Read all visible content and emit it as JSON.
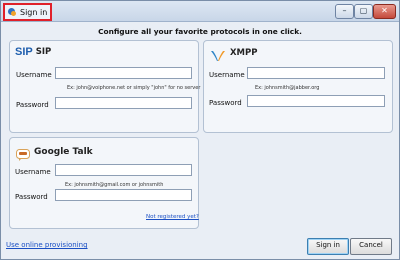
{
  "window": {
    "title": "Sign in",
    "controls": {
      "minimize": "–",
      "maximize": "▢",
      "close": "✕"
    }
  },
  "headline": "Configure all your favorite protocols in one click.",
  "sip": {
    "logo": "SIP",
    "title": "SIP",
    "username_label": "Username",
    "username_value": "",
    "hint": "Ex: john@voiphone.net or simply \"john\" for no server",
    "password_label": "Password",
    "password_value": ""
  },
  "xmpp": {
    "title": "XMPP",
    "username_label": "Username",
    "username_value": "",
    "hint": "Ex: johnsmith@jabber.org",
    "password_label": "Password",
    "password_value": ""
  },
  "gtalk": {
    "title": "Google Talk",
    "username_label": "Username",
    "username_value": "",
    "hint": "Ex: johnsmith@gmail.com or johnsmith",
    "password_label": "Password",
    "password_value": "",
    "register_link": "Not registered yet?"
  },
  "footer": {
    "provisioning_link": "Use online provisioning",
    "sign_in": "Sign in",
    "cancel": "Cancel"
  },
  "colors": {
    "highlight_border": "#e0202a",
    "link": "#1a4fc4",
    "sip_logo": "#1f5fae"
  }
}
